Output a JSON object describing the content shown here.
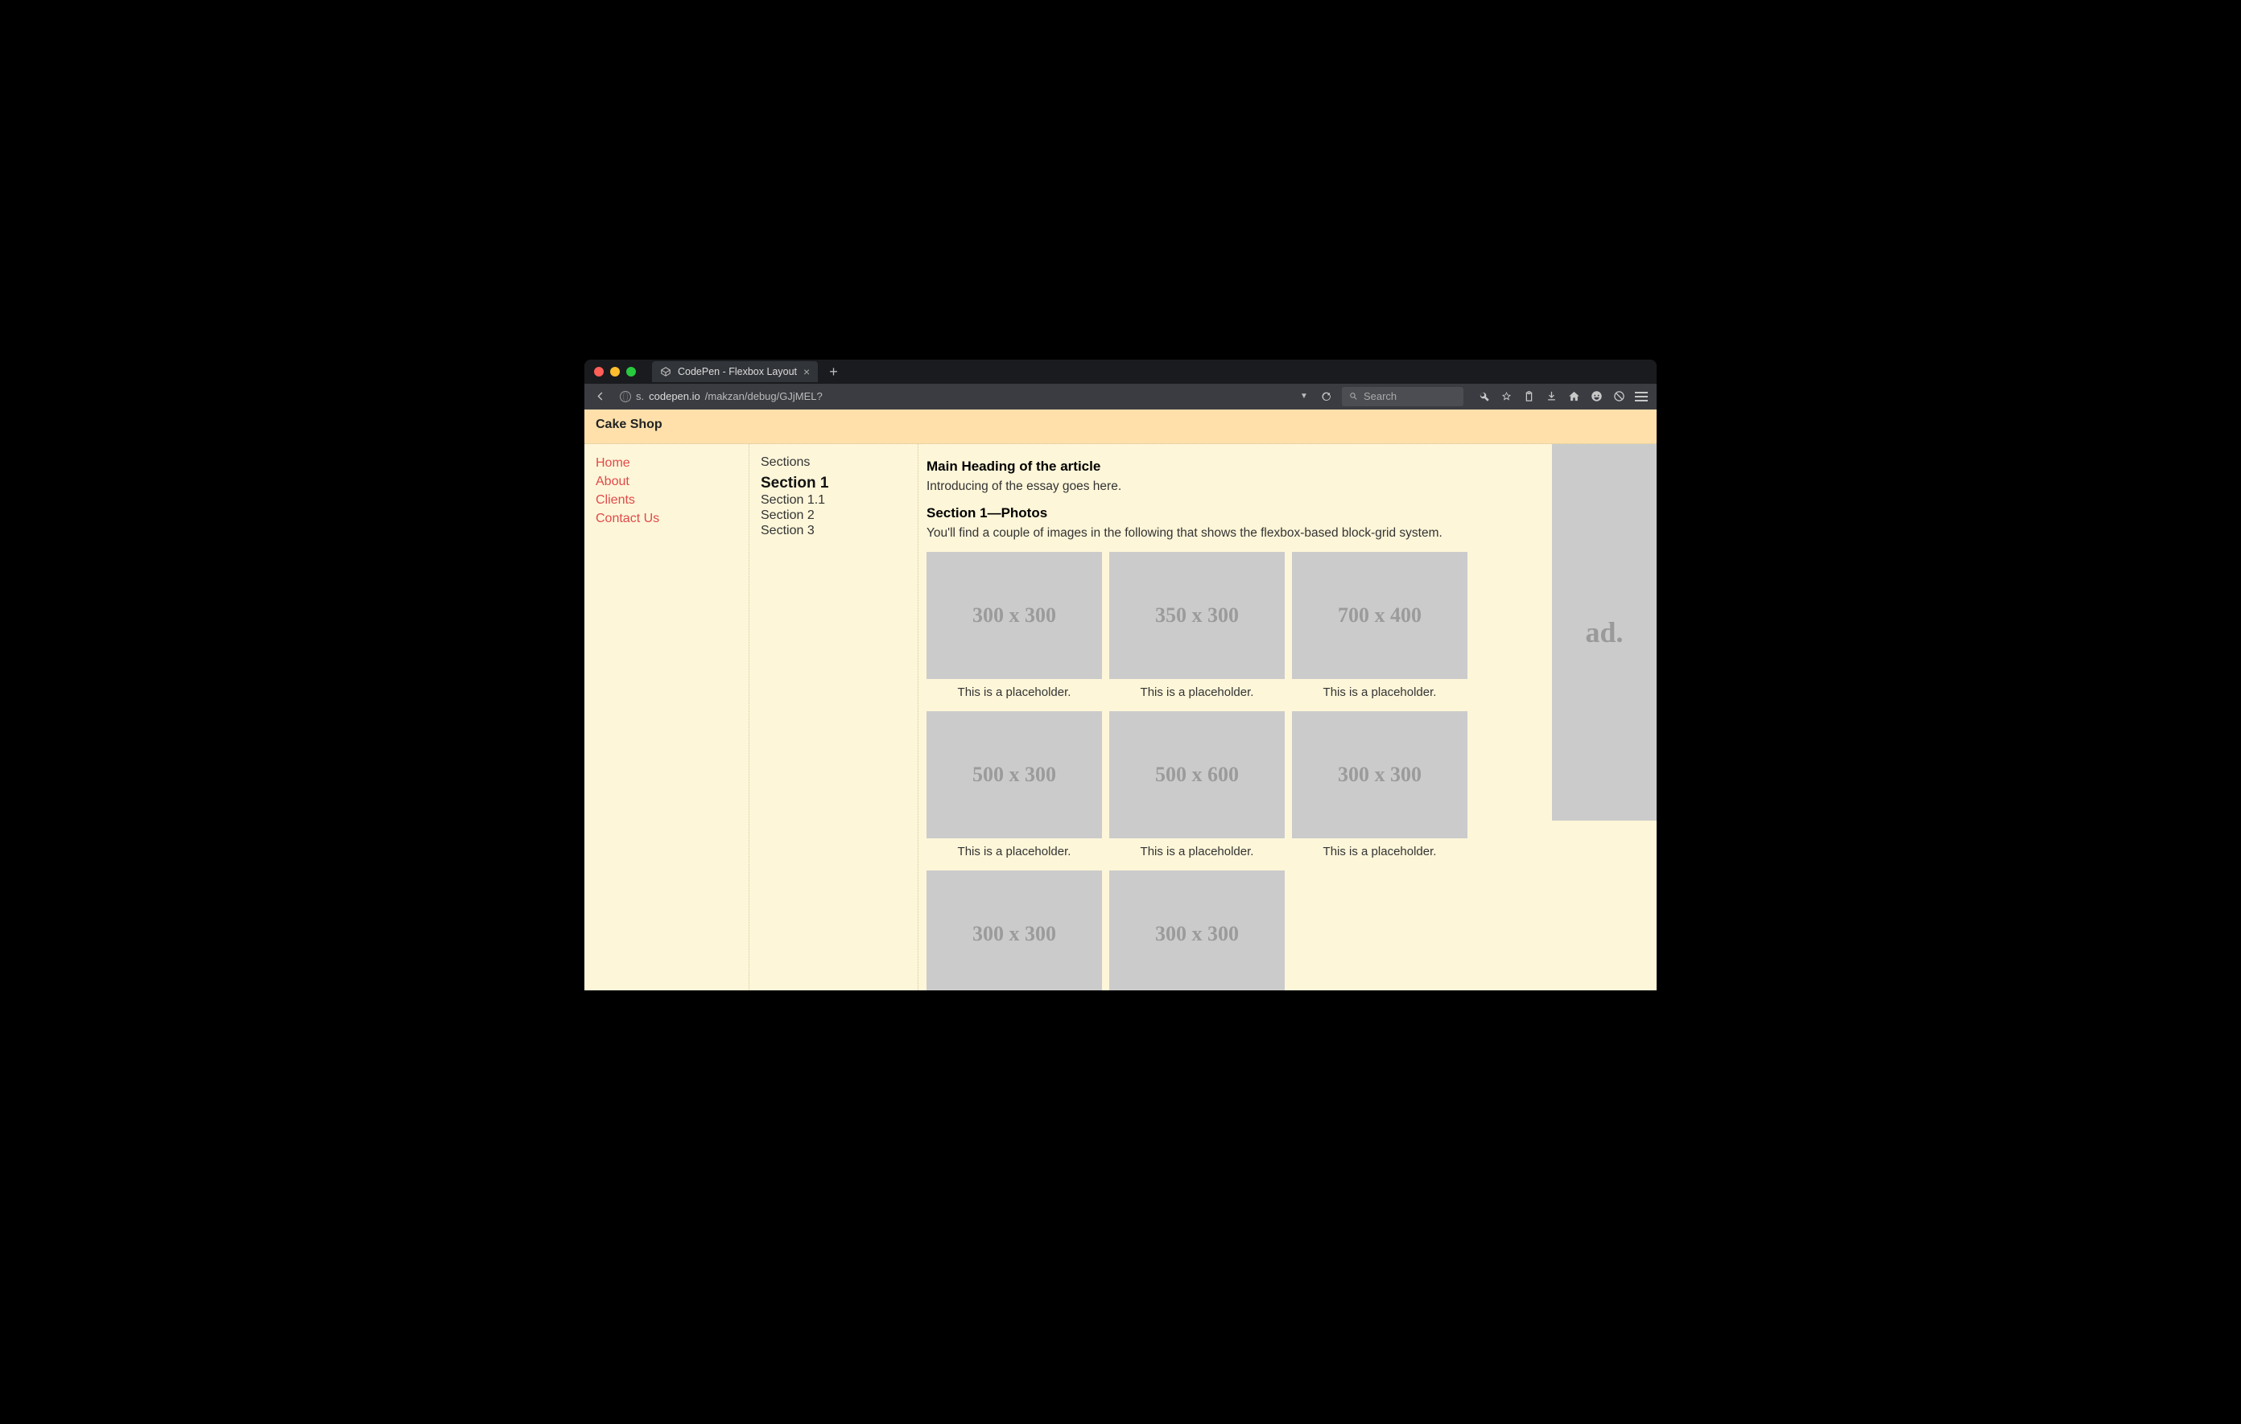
{
  "browser": {
    "tab_title": "CodePen - Flexbox Layout",
    "url_pre": "s.",
    "url_host": "codepen.io",
    "url_path": "/makzan/debug/GJjMEL?",
    "search_placeholder": "Search"
  },
  "site": {
    "title": "Cake Shop"
  },
  "nav": {
    "items": [
      {
        "label": "Home"
      },
      {
        "label": "About"
      },
      {
        "label": "Clients"
      },
      {
        "label": "Contact Us"
      }
    ]
  },
  "toc": {
    "heading": "Sections",
    "items": [
      {
        "label": "Section 1",
        "active": true
      },
      {
        "label": "Section 1.1"
      },
      {
        "label": "Section 2"
      },
      {
        "label": "Section 3"
      }
    ]
  },
  "article": {
    "h1": "Main Heading of the article",
    "intro": "Introducing of the essay goes here.",
    "h2": "Section 1—Photos",
    "desc": "You'll find a couple of images in the following that shows the flexbox-based block-grid system."
  },
  "cards": [
    {
      "dim": "300 x 300",
      "cap": "This is a placeholder."
    },
    {
      "dim": "350 x 300",
      "cap": "This is a placeholder."
    },
    {
      "dim": "700 x 400",
      "cap": "This is a placeholder."
    },
    {
      "dim": "500 x 300",
      "cap": "This is a placeholder."
    },
    {
      "dim": "500 x 600",
      "cap": "This is a placeholder."
    },
    {
      "dim": "300 x 300",
      "cap": "This is a placeholder."
    },
    {
      "dim": "300 x 300",
      "cap": ""
    },
    {
      "dim": "300 x 300",
      "cap": ""
    }
  ],
  "ad": {
    "label": "ad."
  }
}
